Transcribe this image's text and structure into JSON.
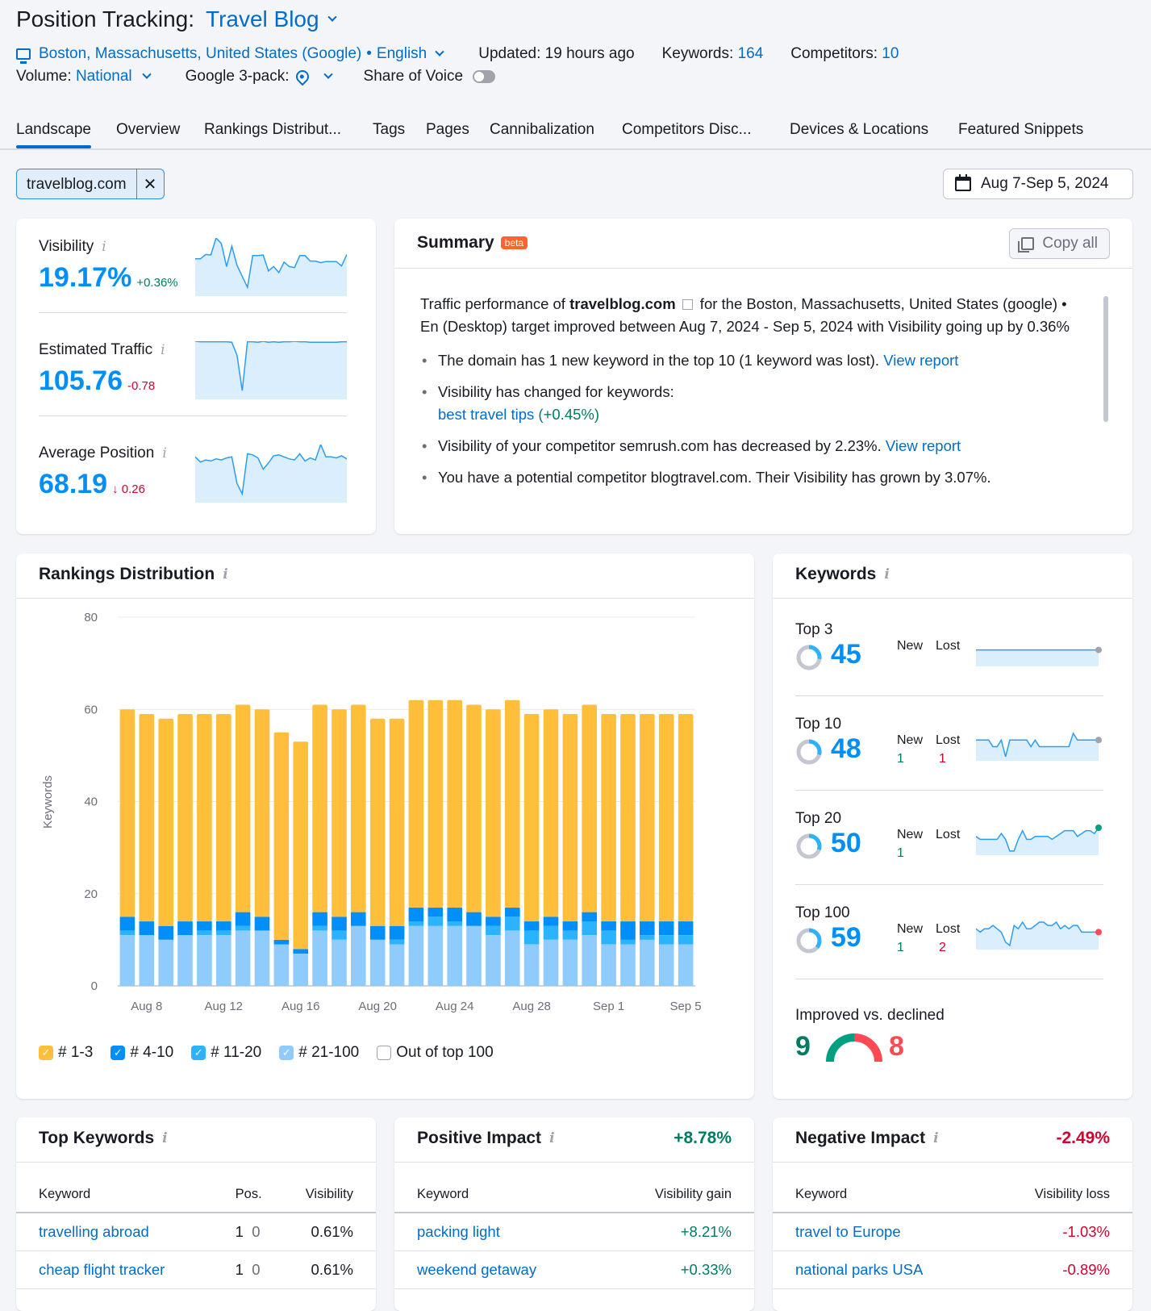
{
  "header": {
    "title_prefix": "Position Tracking:",
    "project": "Travel Blog",
    "location": "Boston, Massachusetts, United States (Google)",
    "language": "English",
    "updated_label": "Updated:",
    "updated_value": "19 hours ago",
    "keywords_label": "Keywords:",
    "keywords_value": "164",
    "competitors_label": "Competitors:",
    "competitors_value": "10",
    "volume_label": "Volume:",
    "volume_value": "National",
    "google3pack_label": "Google 3-pack:",
    "share_of_voice_label": "Share of Voice",
    "share_of_voice_on": false
  },
  "tabs": [
    "Landscape",
    "Overview",
    "Rankings Distribut...",
    "Tags",
    "Pages",
    "Cannibalization",
    "Competitors Disc...",
    "Devices & Locations",
    "Featured Snippets"
  ],
  "active_tab": "Landscape",
  "filter_chip": "travelblog.com",
  "date_range": "Aug 7-Sep 5, 2024",
  "metrics": [
    {
      "name": "Visibility",
      "value": "19.17%",
      "delta": "+0.36%",
      "trend": "up",
      "spark": [
        52,
        52,
        60,
        59,
        90,
        80,
        38,
        75,
        40,
        20,
        0,
        58,
        58,
        59,
        30,
        38,
        27,
        46,
        38,
        36,
        58,
        58,
        48,
        48,
        45,
        47,
        47,
        47,
        39,
        60
      ]
    },
    {
      "name": "Estimated Traffic",
      "value": "105.76",
      "delta": "-0.78",
      "trend": "down",
      "spark": [
        98,
        97,
        97,
        97,
        97,
        97,
        97,
        96,
        70,
        0,
        97,
        97,
        96,
        98,
        96,
        97,
        96,
        97,
        97,
        98,
        97,
        97,
        96,
        96,
        96,
        96,
        96,
        96,
        97,
        97
      ]
    },
    {
      "name": "Average Position",
      "value": "68.19",
      "delta": "↓ 0.26",
      "trend": "down",
      "spark": [
        72,
        62,
        66,
        64,
        68,
        66,
        70,
        72,
        20,
        0,
        78,
        76,
        70,
        48,
        60,
        74,
        76,
        72,
        68,
        66,
        78,
        64,
        70,
        66,
        96,
        72,
        72,
        70,
        74,
        68
      ]
    }
  ],
  "summary": {
    "title": "Summary",
    "badge": "beta",
    "copy_label": "Copy all",
    "intro_before": "Traffic performance of ",
    "intro_domain": "travelblog.com",
    "intro_after": " for the Boston, Massachusetts, United States (google) • En (Desktop) target improved between Aug 7, 2024 - Sep 5, 2024 with Visibility going up by 0.36%",
    "bullets": [
      {
        "text": "The domain has 1 new keyword in the top 10 (1 keyword was lost). ",
        "link": "View report"
      },
      {
        "text": "Visibility has changed for keywords:",
        "kw_link": "best travel tips",
        "kw_delta": "(+0.45%)"
      },
      {
        "text": "Visibility of your competitor semrush.com has decreased by 2.23%. ",
        "link": "View report"
      },
      {
        "text": "You have a potential competitor blogtravel.com. Their Visibility has grown by 3.07%."
      }
    ]
  },
  "rankings": {
    "title": "Rankings Distribution",
    "legend": [
      {
        "label": "# 1-3",
        "color": "#ffbf3b",
        "checked": true
      },
      {
        "label": "# 4-10",
        "color": "#008ff8",
        "checked": true
      },
      {
        "label": "# 11-20",
        "color": "#2bb3ff",
        "checked": true
      },
      {
        "label": "# 21-100",
        "color": "#8fcbfc",
        "checked": true
      },
      {
        "label": "Out of top 100",
        "color": "#ffffff",
        "checked": false
      }
    ]
  },
  "chart_data": {
    "type": "bar",
    "stacked": true,
    "title": "Rankings Distribution",
    "xlabel": "",
    "ylabel": "Keywords",
    "ylim": [
      0,
      80
    ],
    "yticks": [
      0,
      20,
      40,
      60,
      80
    ],
    "grid": true,
    "legend_position": "bottom-left",
    "categories": [
      "Aug 7",
      "Aug 8",
      "Aug 9",
      "Aug 10",
      "Aug 11",
      "Aug 12",
      "Aug 13",
      "Aug 14",
      "Aug 15",
      "Aug 16",
      "Aug 17",
      "Aug 18",
      "Aug 19",
      "Aug 20",
      "Aug 21",
      "Aug 22",
      "Aug 23",
      "Aug 24",
      "Aug 25",
      "Aug 26",
      "Aug 27",
      "Aug 28",
      "Aug 29",
      "Aug 30",
      "Aug 31",
      "Sep 1",
      "Sep 2",
      "Sep 3",
      "Sep 4",
      "Sep 5"
    ],
    "xtick_labels": [
      "Aug 8",
      "Aug 12",
      "Aug 16",
      "Aug 20",
      "Aug 24",
      "Aug 28",
      "Sep 1",
      "Sep 5"
    ],
    "series": [
      {
        "name": "# 21-100",
        "color": "#8fcbfc",
        "values": [
          11,
          11,
          10,
          11,
          11,
          11,
          12,
          12,
          9,
          7,
          12,
          10,
          13,
          10,
          9,
          13,
          13,
          13,
          13,
          11,
          12,
          9,
          10,
          10,
          11,
          9,
          9,
          10,
          9,
          9
        ]
      },
      {
        "name": "# 11-20",
        "color": "#2bb3ff",
        "values": [
          1,
          0,
          0,
          0,
          1,
          1,
          1,
          0,
          0,
          0,
          1,
          2,
          0,
          0,
          1,
          1,
          2,
          1,
          0,
          2,
          3,
          3,
          3,
          2,
          3,
          3,
          1,
          1,
          2,
          2
        ]
      },
      {
        "name": "# 4-10",
        "color": "#008ff8",
        "values": [
          3,
          3,
          3,
          3,
          2,
          2,
          3,
          3,
          1,
          1,
          3,
          3,
          3,
          3,
          3,
          3,
          2,
          3,
          3,
          2,
          2,
          2,
          2,
          2,
          2,
          2,
          4,
          3,
          3,
          3
        ]
      },
      {
        "name": "# 1-3",
        "color": "#ffbf3b",
        "values": [
          45,
          45,
          45,
          45,
          45,
          45,
          45,
          45,
          45,
          45,
          45,
          45,
          45,
          45,
          45,
          45,
          45,
          45,
          45,
          45,
          45,
          45,
          45,
          45,
          45,
          45,
          45,
          45,
          45,
          45
        ]
      }
    ]
  },
  "keywords_panel": {
    "title": "Keywords",
    "new_label": "New",
    "lost_label": "Lost",
    "groups": [
      {
        "label": "Top 3",
        "value": "45",
        "share": 0.27,
        "new": "",
        "lost": "",
        "dot": "#a0a3ab",
        "spark": [
          50,
          50,
          50,
          50,
          50,
          50,
          50,
          50,
          50,
          50,
          50,
          50,
          50,
          50,
          50,
          50,
          50,
          50,
          50,
          50,
          50,
          50,
          50,
          50,
          50,
          50,
          50,
          50,
          50,
          50
        ]
      },
      {
        "label": "Top 10",
        "value": "48",
        "share": 0.29,
        "new": "1",
        "lost": "1",
        "dot": "#a0a3ab",
        "spark": [
          60,
          60,
          60,
          60,
          40,
          40,
          60,
          10,
          60,
          60,
          60,
          60,
          60,
          40,
          60,
          40,
          40,
          40,
          40,
          40,
          40,
          40,
          40,
          80,
          60,
          60,
          60,
          60,
          60,
          60
        ]
      },
      {
        "label": "Top 20",
        "value": "50",
        "share": 0.3,
        "new": "1",
        "lost": "",
        "dot": "#009f81",
        "spark": [
          50,
          40,
          40,
          40,
          40,
          40,
          60,
          40,
          0,
          0,
          40,
          70,
          40,
          40,
          50,
          50,
          50,
          50,
          40,
          50,
          60,
          70,
          70,
          70,
          50,
          60,
          70,
          70,
          60,
          80
        ]
      },
      {
        "label": "Top 100",
        "value": "59",
        "share": 0.36,
        "new": "1",
        "lost": "2",
        "dot": "#ff4953",
        "spark": [
          50,
          40,
          50,
          50,
          60,
          50,
          40,
          10,
          0,
          60,
          50,
          70,
          50,
          50,
          60,
          70,
          70,
          60,
          60,
          70,
          50,
          60,
          50,
          60,
          60,
          40,
          40,
          40,
          40,
          40
        ]
      }
    ],
    "improved_label": "Improved vs. declined",
    "improved": "9",
    "declined": "8"
  },
  "top_keywords": {
    "title": "Top Keywords",
    "columns": [
      "Keyword",
      "Pos.",
      "Visibility"
    ],
    "rows": [
      {
        "keyword": "travelling abroad",
        "pos": "1",
        "change": "0",
        "visibility": "0.61%"
      },
      {
        "keyword": "cheap flight tracker",
        "pos": "1",
        "change": "0",
        "visibility": "0.61%"
      }
    ]
  },
  "positive_impact": {
    "title": "Positive Impact",
    "total": "+8.78%",
    "columns": [
      "Keyword",
      "Visibility gain"
    ],
    "rows": [
      {
        "keyword": "packing light",
        "value": "+8.21%"
      },
      {
        "keyword": "weekend getaway",
        "value": "+0.33%"
      }
    ]
  },
  "negative_impact": {
    "title": "Negative Impact",
    "total": "-2.49%",
    "columns": [
      "Keyword",
      "Visibility loss"
    ],
    "rows": [
      {
        "keyword": "travel to Europe",
        "value": "-1.03%"
      },
      {
        "keyword": "national parks USA",
        "value": "-0.89%"
      }
    ]
  }
}
